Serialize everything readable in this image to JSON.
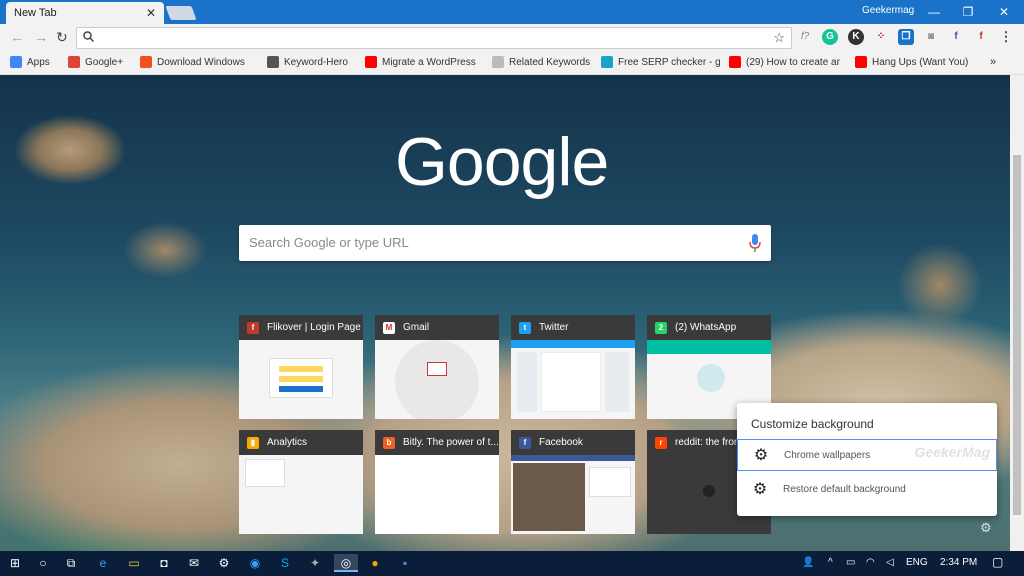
{
  "window": {
    "tab_title": "New Tab",
    "tab_close": "✕",
    "profile": "Geekermag",
    "minimize": "—",
    "maximize": "❐",
    "close": "✕"
  },
  "toolbar": {
    "back": "←",
    "forward": "→",
    "reload": "↻",
    "omnibox_value": "",
    "star": "☆",
    "menu": "⋮"
  },
  "bookmarks": [
    {
      "label": "Apps",
      "icon": "apps-icon",
      "color": "#4285f4"
    },
    {
      "label": "Google+",
      "icon": "google-plus-icon",
      "color": "#db4437"
    },
    {
      "label": "Download Windows",
      "icon": "windows-icon",
      "color": "#f25022"
    },
    {
      "label": "Keyword-Hero",
      "icon": "keyword-hero-icon",
      "color": "#555555"
    },
    {
      "label": "Migrate a WordPress",
      "icon": "youtube-icon",
      "color": "#ff0000"
    },
    {
      "label": "Related Keywords",
      "icon": "page-icon",
      "color": "#bbbbbb"
    },
    {
      "label": "Free SERP checker - g",
      "icon": "plus-icon",
      "color": "#1aa3c8"
    },
    {
      "label": "(29) How to create ar",
      "icon": "youtube-icon",
      "color": "#ff0000"
    },
    {
      "label": "Hang Ups (Want You)",
      "icon": "youtube-icon",
      "color": "#ff0000"
    }
  ],
  "bookmarks_more": "»",
  "ntp": {
    "logo": "Google",
    "search_placeholder": "Search Google or type URL",
    "tiles": [
      {
        "title": "Flikover | Login Page",
        "icon": "flikover-icon",
        "icon_color": "#c0392b",
        "icon_char": "f"
      },
      {
        "title": "Gmail",
        "icon": "gmail-icon",
        "icon_color": "#ffffff",
        "icon_char": "M"
      },
      {
        "title": "Twitter",
        "icon": "twitter-icon",
        "icon_color": "#1da1f2",
        "icon_char": "t"
      },
      {
        "title": "(2) WhatsApp",
        "icon": "whatsapp-icon",
        "icon_color": "#25d366",
        "icon_char": "2"
      },
      {
        "title": "Analytics",
        "icon": "analytics-icon",
        "icon_color": "#f9ab00",
        "icon_char": "▮"
      },
      {
        "title": "Bitly. The power of t...",
        "icon": "bitly-icon",
        "icon_color": "#ee6123",
        "icon_char": "b"
      },
      {
        "title": "Facebook",
        "icon": "facebook-icon",
        "icon_color": "#3b5998",
        "icon_char": "f"
      },
      {
        "title": "reddit: the front",
        "icon": "reddit-icon",
        "icon_color": "#ff4500",
        "icon_char": "r"
      }
    ],
    "popup": {
      "title": "Customize background",
      "item1": "Chrome wallpapers",
      "item2": "Restore default background",
      "watermark": "GeekerMag"
    }
  },
  "taskbar": {
    "language": "ENG",
    "time": "2:34 PM"
  }
}
